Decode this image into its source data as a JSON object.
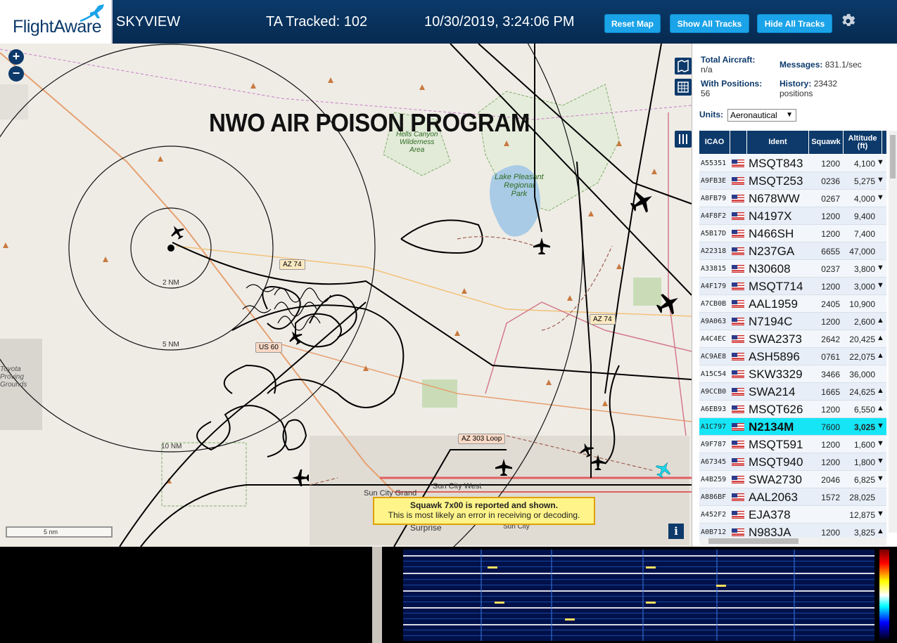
{
  "header": {
    "logo": "FlightAware",
    "app_name": "SKYVIEW",
    "tracked": "TA Tracked: 102",
    "datetime": "10/30/2019, 3:24:06 PM",
    "buttons": {
      "reset_map": "Reset Map",
      "show_all": "Show All Tracks",
      "hide_all": "Hide All Tracks"
    }
  },
  "map": {
    "overlay_title": "NWO AIR POISON PROGRAM",
    "zoom_in": "+",
    "zoom_out": "−",
    "range_labels": {
      "r2": "2 NM",
      "r5": "5 NM",
      "r10": "10 NM"
    },
    "scale": "5 nm",
    "info": "i",
    "places": {
      "hells_canyon": "Hells Canyon\nWilderness\nArea",
      "lake_pleasant": "Lake Pleasant\nRegional\nPark",
      "proving": "Toyota\nProving\nGrounds",
      "sun_city_west": "Sun City West",
      "sun_city_grand": "Sun City Grand",
      "surprise": "Surprise",
      "sun_city": "Sun City"
    },
    "roads": {
      "az74a": "AZ 74",
      "az74b": "AZ 74",
      "us60": "US 60",
      "az303": "AZ 303 Loop"
    },
    "warning": {
      "title": "Squawk 7x00 is reported and shown.",
      "body": "This is most likely an error in receiving or decoding."
    }
  },
  "stats": {
    "total_label": "Total Aircraft:",
    "total_value": "n/a",
    "messages_label": "Messages:",
    "messages_value": "831.1/sec",
    "positions_label": "With Positions:",
    "positions_value": "56",
    "history_label": "History:",
    "history_value": "23432",
    "history_unit": "positions"
  },
  "units": {
    "label": "Units:",
    "selected": "Aeronautical"
  },
  "table": {
    "headers": {
      "icao": "ICAO",
      "ident": "Ident",
      "squawk": "Squawk",
      "altitude": "Altitude (ft)"
    },
    "rows": [
      {
        "icao": "A55351",
        "ident": "MSQT843",
        "squawk": "1200",
        "alt": "4,100",
        "trend": "▼"
      },
      {
        "icao": "A9FB3E",
        "ident": "MSQT253",
        "squawk": "0236",
        "alt": "5,275",
        "trend": "▼"
      },
      {
        "icao": "A8FB79",
        "ident": "N678WW",
        "squawk": "0267",
        "alt": "4,000",
        "trend": "▼"
      },
      {
        "icao": "A4F8F2",
        "ident": "N4197X",
        "squawk": "1200",
        "alt": "9,400",
        "trend": ""
      },
      {
        "icao": "A5B17D",
        "ident": "N466SH",
        "squawk": "1200",
        "alt": "7,400",
        "trend": ""
      },
      {
        "icao": "A22318",
        "ident": "N237GA",
        "squawk": "6655",
        "alt": "47,000",
        "trend": ""
      },
      {
        "icao": "A33815",
        "ident": "N30608",
        "squawk": "0237",
        "alt": "3,800",
        "trend": "▼"
      },
      {
        "icao": "A4F179",
        "ident": "MSQT714",
        "squawk": "1200",
        "alt": "3,000",
        "trend": "▼"
      },
      {
        "icao": "A7CB0B",
        "ident": "AAL1959",
        "squawk": "2405",
        "alt": "10,900",
        "trend": ""
      },
      {
        "icao": "A9A063",
        "ident": "N7194C",
        "squawk": "1200",
        "alt": "2,600",
        "trend": "▲"
      },
      {
        "icao": "A4C4EC",
        "ident": "SWA2373",
        "squawk": "2642",
        "alt": "20,425",
        "trend": "▲"
      },
      {
        "icao": "AC9AE8",
        "ident": "ASH5896",
        "squawk": "0761",
        "alt": "22,075",
        "trend": "▲"
      },
      {
        "icao": "A15C54",
        "ident": "SKW3329",
        "squawk": "3466",
        "alt": "36,000",
        "trend": ""
      },
      {
        "icao": "A9CCB0",
        "ident": "SWA214",
        "squawk": "1665",
        "alt": "24,625",
        "trend": "▲"
      },
      {
        "icao": "A6EB93",
        "ident": "MSQT626",
        "squawk": "1200",
        "alt": "6,550",
        "trend": "▲"
      },
      {
        "icao": "A1C797",
        "ident": "N2134M",
        "squawk": "7600",
        "alt": "3,025",
        "trend": "▼"
      },
      {
        "icao": "A9F787",
        "ident": "MSQT591",
        "squawk": "1200",
        "alt": "1,600",
        "trend": "▼"
      },
      {
        "icao": "A67345",
        "ident": "MSQT940",
        "squawk": "1200",
        "alt": "1,800",
        "trend": "▼"
      },
      {
        "icao": "A4B259",
        "ident": "SWA2730",
        "squawk": "2046",
        "alt": "6,825",
        "trend": "▼"
      },
      {
        "icao": "A886BF",
        "ident": "AAL2063",
        "squawk": "1572",
        "alt": "28,025",
        "trend": ""
      },
      {
        "icao": "A452F2",
        "ident": "EJA378",
        "squawk": "",
        "alt": "12,875",
        "trend": "▼"
      },
      {
        "icao": "A0B712",
        "ident": "N983JA",
        "squawk": "1200",
        "alt": "3,825",
        "trend": "▲"
      }
    ],
    "selected_icao": "A1C797"
  },
  "colors": {
    "header_bg": "#062a50",
    "button": "#1aa3e8",
    "selected_row": "#16e5f5",
    "map_bg": "#efece6"
  }
}
